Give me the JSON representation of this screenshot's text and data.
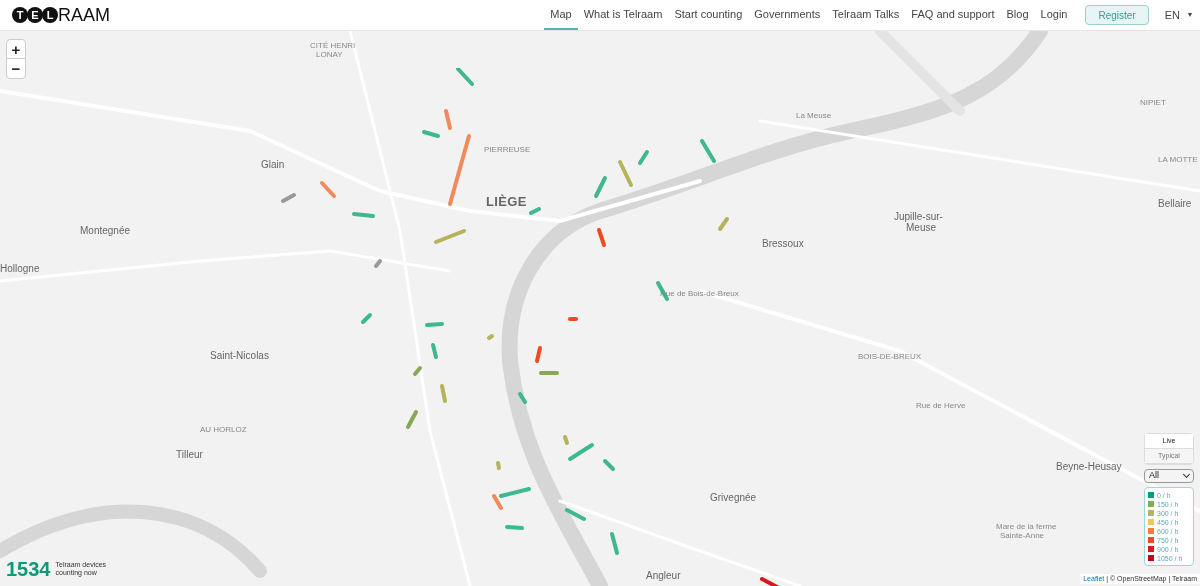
{
  "logo": {
    "circled": [
      "T",
      "E",
      "L"
    ],
    "rest": "RAAM"
  },
  "nav": [
    {
      "label": "Map",
      "selected": true
    },
    {
      "label": "What is Telraam",
      "selected": false
    },
    {
      "label": "Start counting",
      "selected": false
    },
    {
      "label": "Governments",
      "selected": false
    },
    {
      "label": "Telraam Talks",
      "selected": false
    },
    {
      "label": "FAQ and support",
      "selected": false
    },
    {
      "label": "Blog",
      "selected": false
    },
    {
      "label": "Login",
      "selected": false
    }
  ],
  "register": "Register",
  "language": {
    "value": "EN",
    "caret": "▾"
  },
  "zoom": {
    "in": "+",
    "out": "−"
  },
  "places": [
    {
      "text": "LIÈGE",
      "kind": "city"
    },
    {
      "text": "Glain",
      "kind": "town"
    },
    {
      "text": "Montegnée",
      "kind": "town"
    },
    {
      "text": "Hollogne",
      "kind": "town"
    },
    {
      "text": "Saint-Nicolas",
      "kind": "town"
    },
    {
      "text": "Tilleur",
      "kind": "town"
    },
    {
      "text": "Angleur",
      "kind": "town"
    },
    {
      "text": "Grivegnée",
      "kind": "town"
    },
    {
      "text": "Bressoux",
      "kind": "town"
    },
    {
      "text": "Jupille-sur-",
      "kind": "town"
    },
    {
      "text": "Meuse",
      "kind": "town"
    },
    {
      "text": "Beyne-Heusay",
      "kind": "town"
    },
    {
      "text": "Bellaire",
      "kind": "town"
    },
    {
      "text": "PIERREUSE",
      "kind": "district"
    },
    {
      "text": "CITÉ HENRI",
      "kind": "district"
    },
    {
      "text": "LONAY",
      "kind": "district"
    },
    {
      "text": "AU HORLOZ",
      "kind": "district"
    },
    {
      "text": "BOIS-DE-BREUX",
      "kind": "district"
    },
    {
      "text": "NIPIET",
      "kind": "district"
    },
    {
      "text": "LA MOTTE",
      "kind": "district"
    },
    {
      "text": "Rue de Herve",
      "kind": "street"
    },
    {
      "text": "Rue de Bois-de-Breux",
      "kind": "street"
    },
    {
      "text": "La Meuse",
      "kind": "street"
    },
    {
      "text": "Mare de la ferme",
      "kind": "district"
    },
    {
      "text": "Sainte-Anne",
      "kind": "district"
    }
  ],
  "modes": [
    {
      "label": "Live",
      "selected": true
    },
    {
      "label": "Typical",
      "selected": false
    }
  ],
  "filter": "All",
  "legend": [
    {
      "label": "0 / h",
      "color": "#0b9a76"
    },
    {
      "label": "150 / h",
      "color": "#86a957"
    },
    {
      "label": "300 / h",
      "color": "#b5b45a"
    },
    {
      "label": "450 / h",
      "color": "#f1c857"
    },
    {
      "label": "600 / h",
      "color": "#f0803c"
    },
    {
      "label": "750 / h",
      "color": "#ef4a24"
    },
    {
      "label": "900 / h",
      "color": "#d7191c"
    },
    {
      "label": "1050 / h",
      "color": "#c4001d"
    }
  ],
  "counter": {
    "value": "1534",
    "caption": "Telraam devices counting now"
  },
  "attribution": {
    "link": "Leaflet",
    "rest": "| © OpenStreetMap | Telraam"
  }
}
